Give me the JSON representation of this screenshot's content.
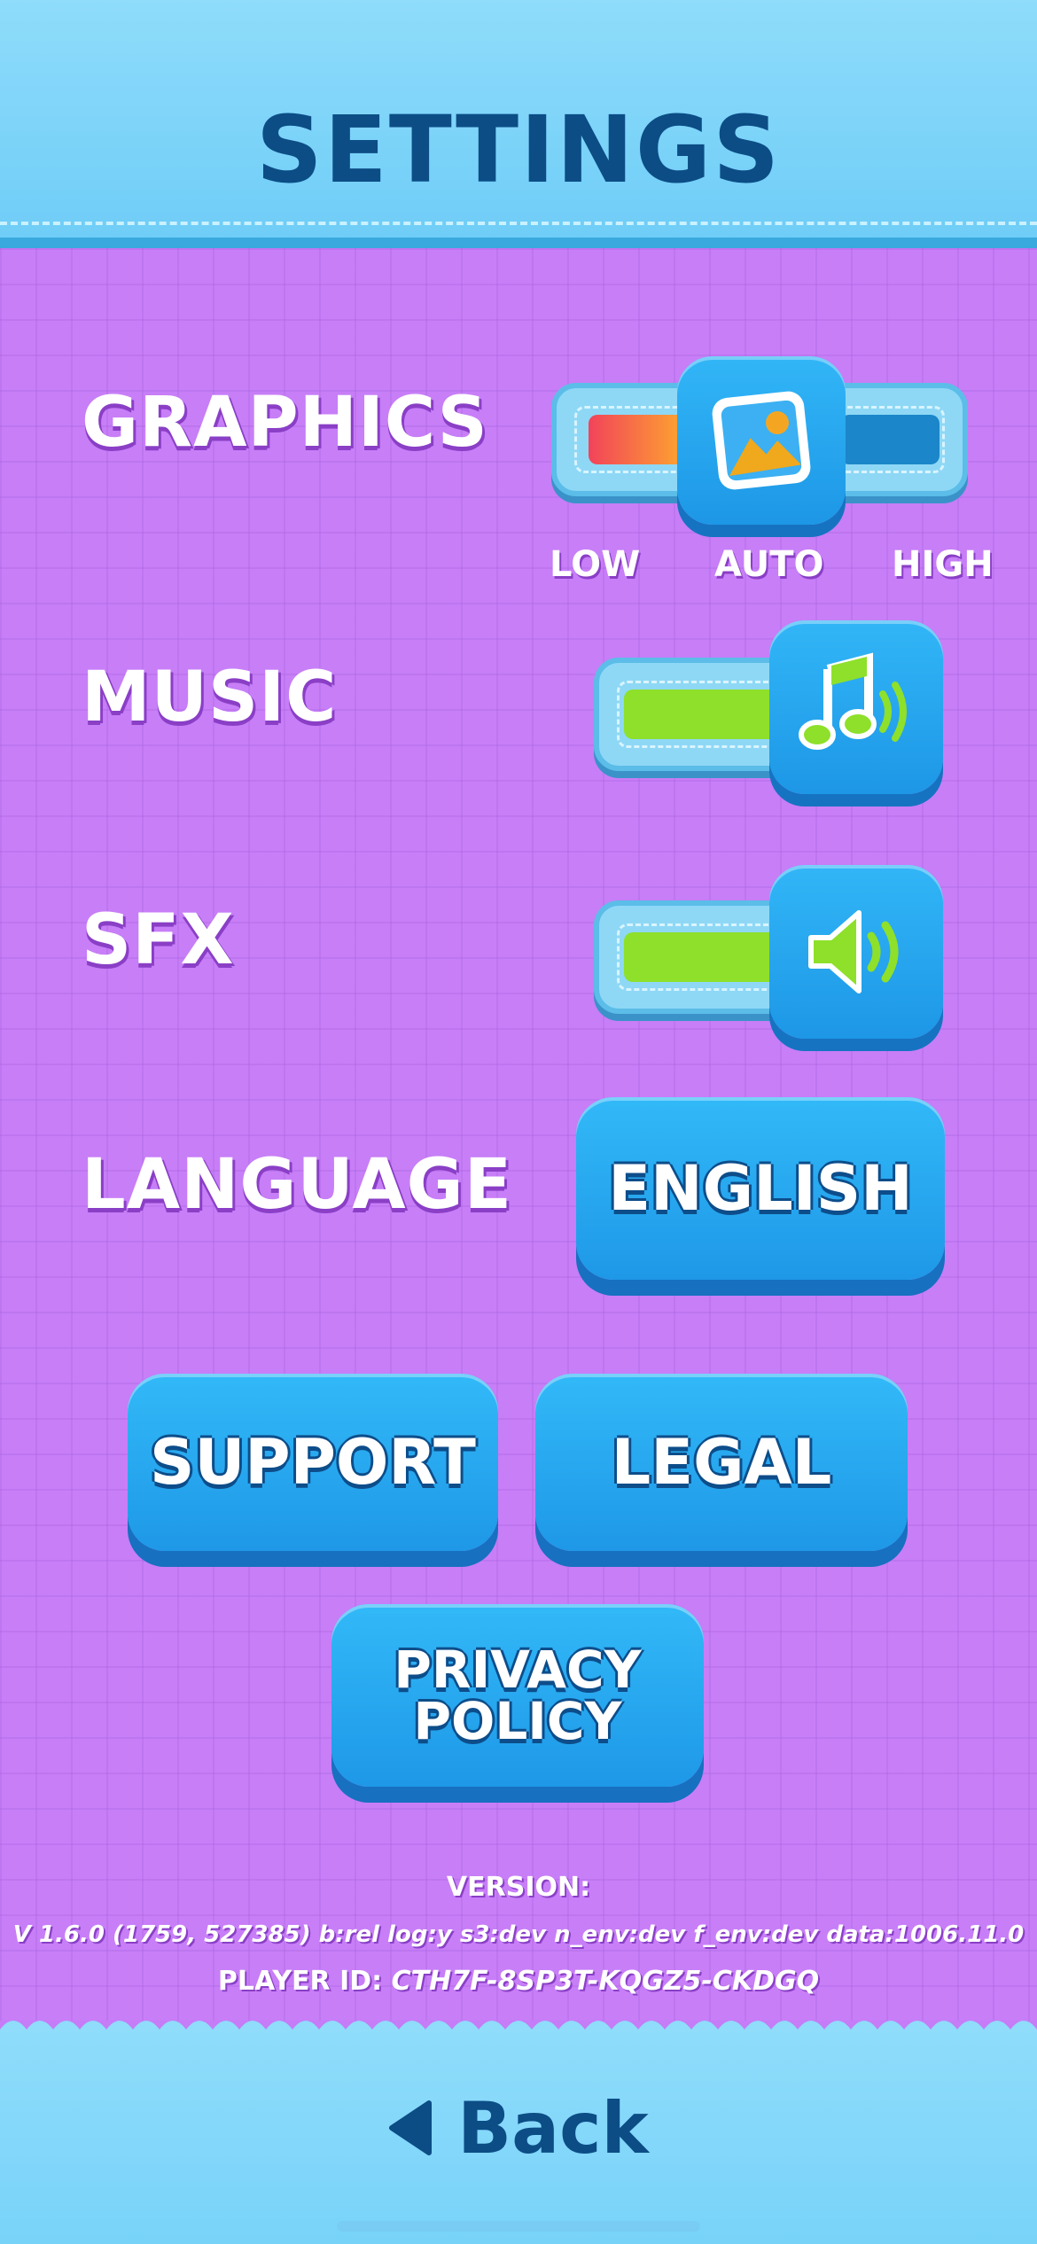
{
  "header": {
    "title": "SETTINGS"
  },
  "rows": {
    "graphics": {
      "label": "GRAPHICS",
      "scale": [
        "LOW",
        "AUTO",
        "HIGH"
      ],
      "selected": "AUTO"
    },
    "music": {
      "label": "MUSIC",
      "enabled": true
    },
    "sfx": {
      "label": "SFX",
      "enabled": true
    },
    "language": {
      "label": "LANGUAGE",
      "value": "ENGLISH"
    }
  },
  "buttons": {
    "support": "SUPPORT",
    "legal": "LEGAL",
    "privacy_line1": "PRIVACY",
    "privacy_line2": "POLICY"
  },
  "info": {
    "version_title": "VERSION:",
    "version_text": "V 1.6.0 (1759, 527385)  b:rel log:y s3:dev n_env:dev f_env:dev data:1006.11.0",
    "player_id_label": "PLAYER ID:",
    "player_id_value": "CTH7F-8SP3T-KQGZ5-CKDGQ"
  },
  "footer": {
    "back_label": "Back"
  },
  "colors": {
    "background": "#c57cf6",
    "header": "#8fdcfb",
    "title_text": "#0c4d86",
    "button": "#1e98e7",
    "toggle_on": "#8ee02a"
  },
  "icons": {
    "graphics_knob": "image-landscape-icon",
    "music_knob": "music-note-icon",
    "sfx_knob": "speaker-icon",
    "back": "back-triangle-icon"
  }
}
